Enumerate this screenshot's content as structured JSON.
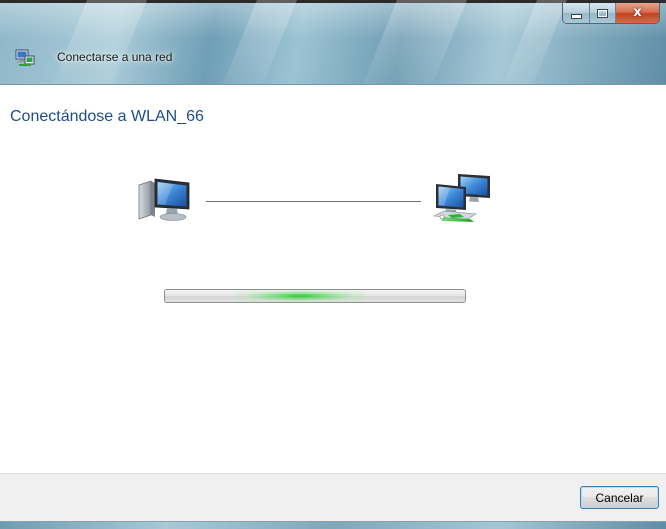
{
  "window": {
    "title": "Conectarse a una red",
    "caption_buttons": {
      "minimize_icon": "minimize-icon",
      "maximize_icon": "maximize-icon",
      "close_glyph": "x"
    }
  },
  "content": {
    "heading": "Conectándose a WLAN_66",
    "left_icon": "computer-icon",
    "right_icon": "network-icon",
    "progress_state": "indeterminate"
  },
  "footer": {
    "cancel_label": "Cancelar"
  },
  "colors": {
    "heading": "#1e4d88",
    "progress_glow": "#24c832",
    "close_button": "#c04420"
  }
}
